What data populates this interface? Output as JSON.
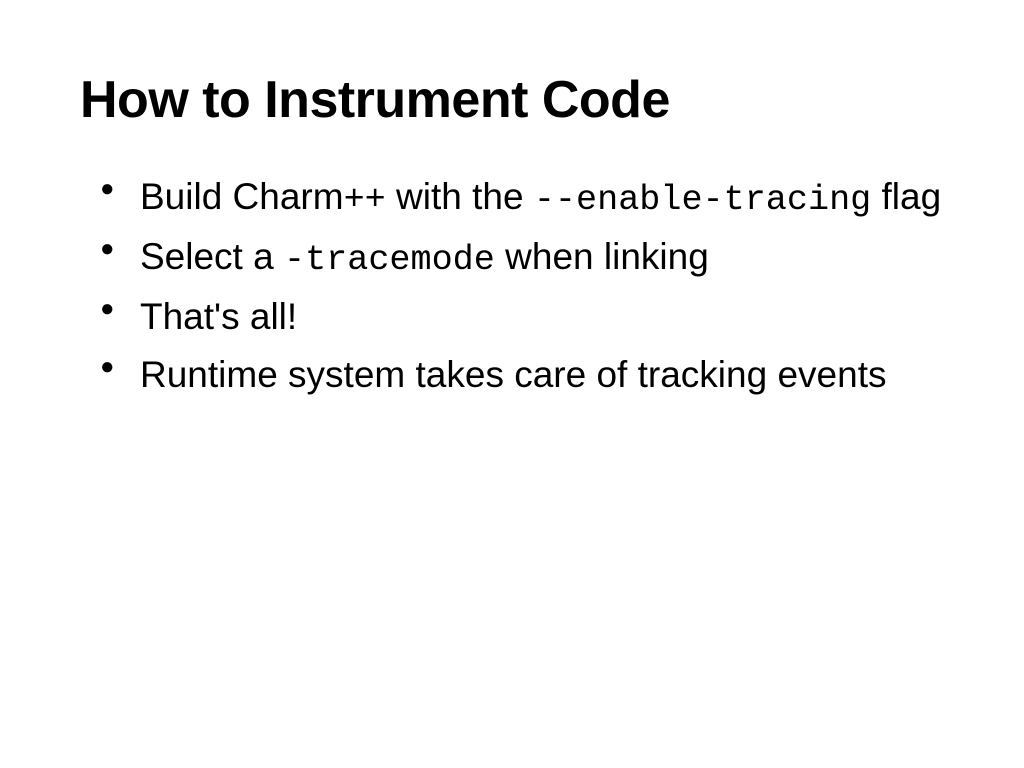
{
  "slide": {
    "title": "How to Instrument Code",
    "bullets": [
      {
        "parts": [
          {
            "text": "Build Charm",
            "code": false
          },
          {
            "text": "++",
            "code": true
          },
          {
            "text": " with the ",
            "code": false
          },
          {
            "text": "--enable-tracing",
            "code": true
          },
          {
            "text": " flag",
            "code": false
          }
        ]
      },
      {
        "parts": [
          {
            "text": "Select a ",
            "code": false
          },
          {
            "text": "-tracemode",
            "code": true
          },
          {
            "text": " when linking",
            "code": false
          }
        ]
      },
      {
        "parts": [
          {
            "text": "That's all!",
            "code": false
          }
        ]
      },
      {
        "parts": [
          {
            "text": "Runtime system takes care of tracking events",
            "code": false
          }
        ]
      }
    ]
  }
}
